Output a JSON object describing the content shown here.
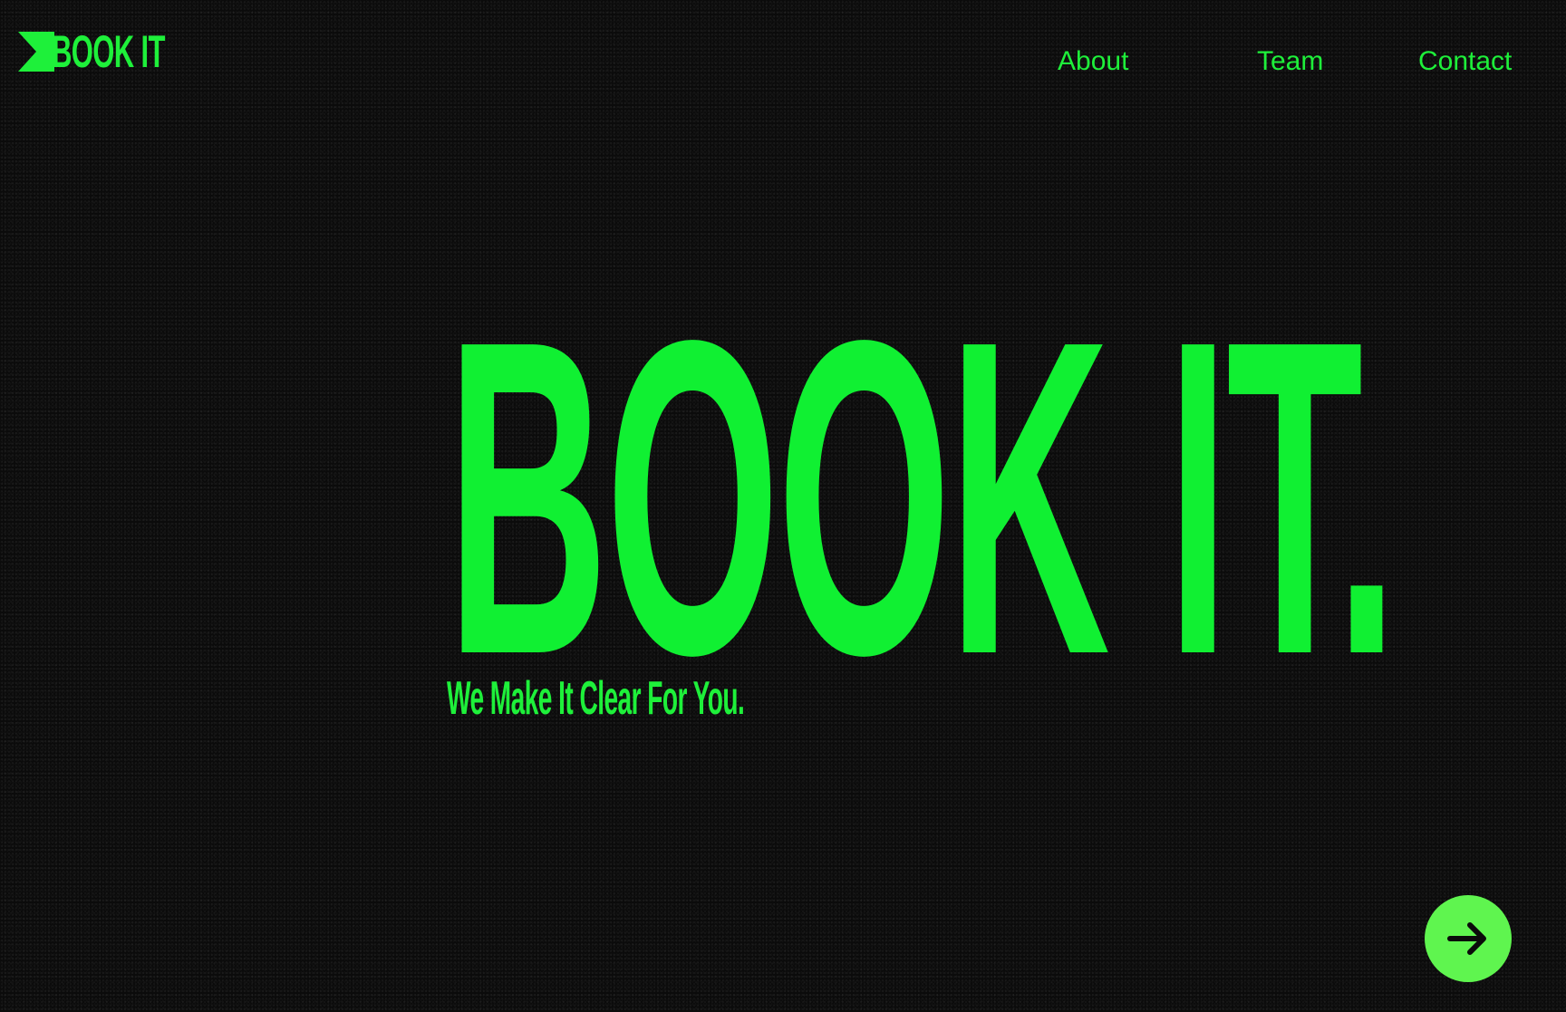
{
  "brand": {
    "logo_text": "BOOK IT",
    "logo_icon": "flag-arrow-icon",
    "accent_color": "#10f032",
    "background_color": "#0b0b0b"
  },
  "nav": {
    "items": [
      {
        "label": "About"
      },
      {
        "label": "Team"
      },
      {
        "label": "Contact"
      }
    ]
  },
  "hero": {
    "title": "BOOK IT.",
    "tagline": "We  Make It Clear For You."
  },
  "next_button": {
    "icon": "arrow-right-icon",
    "color": "#5ff54f"
  }
}
